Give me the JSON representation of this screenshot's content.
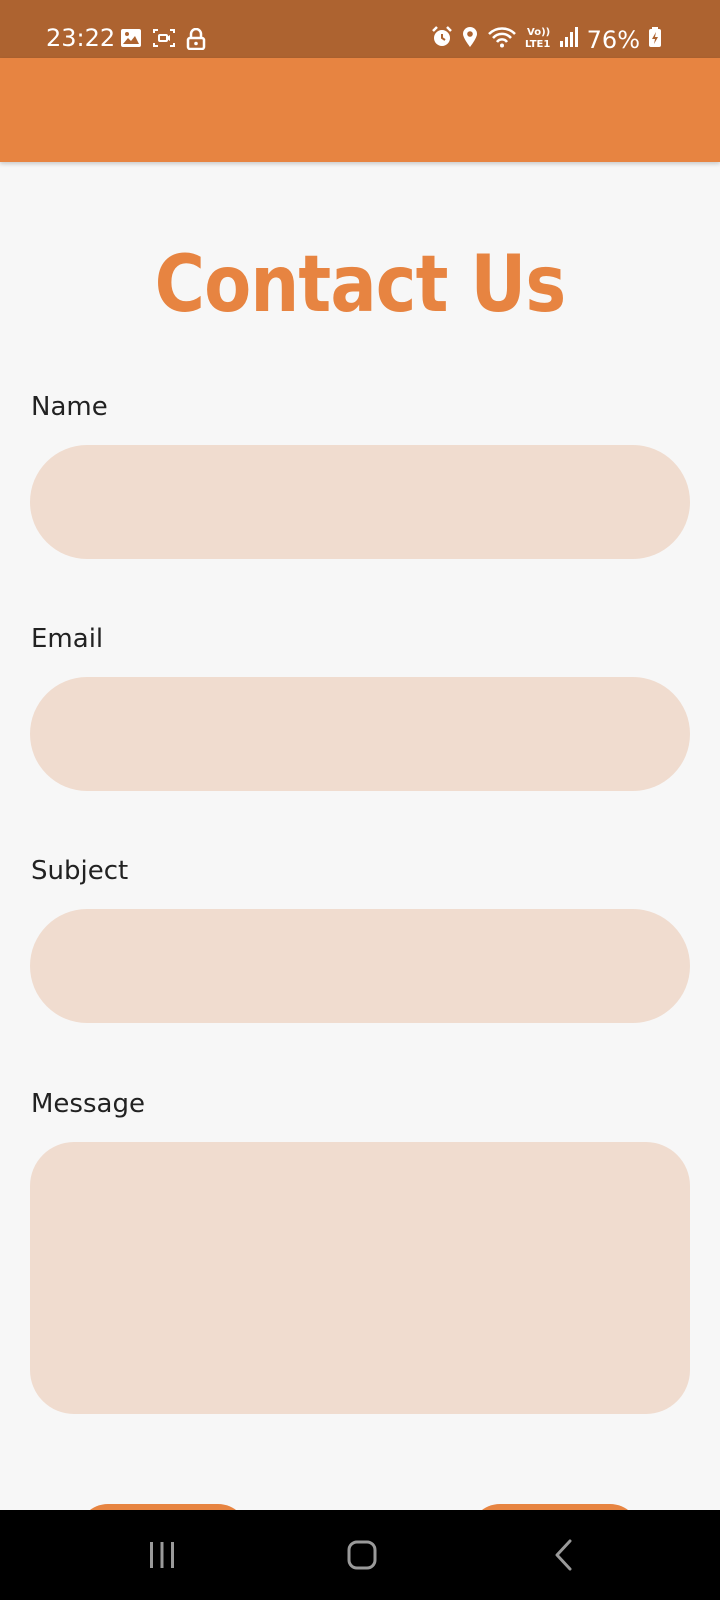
{
  "status_bar": {
    "time": "23:22",
    "battery": "76%",
    "left_icons": [
      "image-icon",
      "screen-record-icon",
      "lock-icon"
    ],
    "right_icons": [
      "alarm-icon",
      "location-icon",
      "wifi-icon",
      "volte-lte-icon",
      "signal-icon",
      "battery-charging-icon"
    ]
  },
  "colors": {
    "status_bar_bg": "#ad6330",
    "app_bar_bg": "#e78441",
    "accent": "#e78441",
    "field_bg": "#f0dccf",
    "page_bg": "#f7f7f7"
  },
  "form": {
    "title": "Contact Us",
    "name_label": "Name",
    "name_value": "",
    "email_label": "Email",
    "email_value": "",
    "subject_label": "Subject",
    "subject_value": "",
    "message_label": "Message",
    "message_value": ""
  },
  "nav_bar": {
    "buttons": [
      "recent-apps-icon",
      "home-icon",
      "back-icon"
    ]
  }
}
